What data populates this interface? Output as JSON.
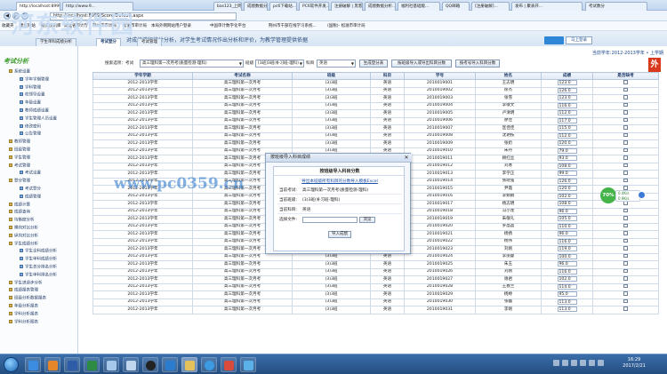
{
  "browser": {
    "address": "http://localhost:8999/Score/Default.aspx",
    "tabs": [
      "http://localhost:8999...",
      "http://www.9...",
      "bas123_上网...",
      "成绩数据分析...",
      "pc6下载站...",
      "PC6软件开发...",
      "注册破解 | 黑客...",
      "成绩数据分析...",
      "福利社基础版...",
      "QQ邮箱",
      "[注册破解]...",
      "发布 | 聚表开...",
      "考试数分"
    ],
    "favorites": [
      "收藏夹",
      "建议网站",
      "网页快讯库",
      "湖北省审计厅",
      "荆州市审计局",
      "松滋市审计局",
      "本局外网网站用户登录",
      "中国审计数字化平台",
      "荆州市干部在线学习系统...",
      "(国税)- 松滋市审计局"
    ]
  },
  "site": {
    "logo": "河东软件园",
    "subtitle": "对成绩进行统计分析，对学生考试情况作出分析和评价，为教学管理提供依据",
    "login_label": "马上登录",
    "watermark_url": "www.pc0359.cn"
  },
  "app_tabs": [
    "学生单科成绩分析",
    "考试登分",
    "考试管理"
  ],
  "sidebar": {
    "title": "考试分析",
    "items": [
      {
        "label": "系统设置",
        "level": 0
      },
      {
        "label": "学年学期管理",
        "level": 1
      },
      {
        "label": "学科管理",
        "level": 1
      },
      {
        "label": "校领导设置",
        "level": 1
      },
      {
        "label": "年级设置",
        "level": 1
      },
      {
        "label": "教师成绩设置",
        "level": 1
      },
      {
        "label": "学生管理人员设置",
        "level": 1
      },
      {
        "label": "修改密码",
        "level": 1
      },
      {
        "label": "公告管理",
        "level": 1
      },
      {
        "label": "教师管理",
        "level": 0
      },
      {
        "label": "班级管理",
        "level": 0
      },
      {
        "label": "学生管理",
        "level": 0
      },
      {
        "label": "考试管理",
        "level": 0
      },
      {
        "label": "考试设置",
        "level": 1
      },
      {
        "label": "登分管理",
        "level": 0
      },
      {
        "label": "考试登分",
        "level": 1
      },
      {
        "label": "成绩管理",
        "level": 1
      },
      {
        "label": "成绩计算",
        "level": 0
      },
      {
        "label": "成绩查询",
        "level": 0
      },
      {
        "label": "均衡度分析",
        "level": 0
      },
      {
        "label": "横向对比分析",
        "level": 0
      },
      {
        "label": "纵向对比分析",
        "level": 0
      },
      {
        "label": "学生成绩分析",
        "level": 0
      },
      {
        "label": "学生全科成绩分析",
        "level": 1
      },
      {
        "label": "学生单科成绩分析",
        "level": 1
      },
      {
        "label": "学生总分排名分析",
        "level": 1
      },
      {
        "label": "学生单科排名分析",
        "level": 1
      },
      {
        "label": "学生进退步分析",
        "level": 0
      },
      {
        "label": "成绩报表管理",
        "level": 0
      },
      {
        "label": "班级分析数据报表",
        "level": 0
      },
      {
        "label": "年级分析报表",
        "level": 0
      },
      {
        "label": "学科分析报表",
        "level": 0
      },
      {
        "label": "学科分析图表",
        "level": 0
      }
    ]
  },
  "breadcrumb": "当前学年:2012-2013学年 • 上学期",
  "toolbar": {
    "label_exam": "搜索选项：考试",
    "exam_value": "高三理科第一次月考(质量检测-理科)",
    "label_class": "班级",
    "class_value": "[3班]3班(补习班-理科)",
    "label_subject": "科目",
    "subject_value": "英语",
    "btn_generate": "生成登分表",
    "btn_import": "按班级导入或导出科目分数",
    "btn_byid": "按考号导入科目分数",
    "badge": "外"
  },
  "table": {
    "headers": [
      "学年学期",
      "考试名称",
      "班级",
      "科目",
      "学号",
      "姓名",
      "成绩",
      "是否缺考"
    ],
    "term": "2012-2013学年",
    "exam": "高三理科第一次月考",
    "cls": "(3)3班",
    "subject": "英语",
    "rows": [
      [
        "2010019001",
        "王志明",
        "123.0"
      ],
      [
        "2010019002",
        "徐杰",
        "126.0"
      ],
      [
        "2010019003",
        "张雪",
        "123.0"
      ],
      [
        "2010019004",
        "李敬文",
        "116.0"
      ],
      [
        "2010019005",
        "卢清明",
        "112.0"
      ],
      [
        "2010019006",
        "廖佳",
        "117.0"
      ],
      [
        "2010019007",
        "匡佳佳",
        "115.0"
      ],
      [
        "2010019008",
        "沈艳枝",
        "112.0"
      ],
      [
        "2010019009",
        "张奶",
        "120.0"
      ],
      [
        "2010019010",
        "朱丹",
        "79.0"
      ],
      [
        "2010019011",
        "顾红丝",
        "93.0"
      ],
      [
        "2010019012",
        "刘寒",
        "108.0"
      ],
      [
        "2010019013",
        "李学正",
        "99.0"
      ],
      [
        "2010019014",
        "张晓强",
        "126.0"
      ],
      [
        "2010019015",
        "尹霞",
        "120.0"
      ],
      [
        "2010019016",
        "李娟娟",
        "102.0"
      ],
      [
        "2010019017",
        "杨志明",
        "108.0"
      ],
      [
        "2010019018",
        "冯小龙",
        "96.0"
      ],
      [
        "2010019019",
        "朱敬礼",
        "105.0"
      ],
      [
        "2010019020",
        "罗晶晶",
        "110.0"
      ],
      [
        "2010019021",
        "杨扬",
        "96.0"
      ],
      [
        "2010019022",
        "杨伟",
        "116.0"
      ],
      [
        "2010019023",
        "刘刚",
        "119.0"
      ],
      [
        "2010019024",
        "李丽曼",
        "100.0"
      ],
      [
        "2010019025",
        "朱玉",
        "96.0"
      ],
      [
        "2010019026",
        "刘刚",
        "116.0"
      ],
      [
        "2010019027",
        "谢君",
        "102.0"
      ],
      [
        "2010019028",
        "王春兰",
        "114.0"
      ],
      [
        "2010019029",
        "杨婷",
        "95.0"
      ],
      [
        "2010019030",
        "张磊",
        "113.0"
      ],
      [
        "2010019031",
        "李刚",
        "113.0"
      ]
    ]
  },
  "dialog": {
    "title": "按班级导入科目成绩",
    "heading": "按班级导入科目分数",
    "link": "导出本班级所有科目的分数导入模板Excel",
    "label_exam": "当前考试:",
    "exam": "高三理科第一次月考(质量检测-理科)",
    "label_class": "当前班级:",
    "cls": "(3)3班(补习班-理科)",
    "label_subject": "当前科目:",
    "subject": "英语",
    "label_file": "选择文件:",
    "browse": "浏览",
    "import": "导入成绩",
    "close": "✕"
  },
  "widget": {
    "percent": "70%",
    "up": "0.4K/s",
    "down": "0.9K/s"
  },
  "taskbar": {
    "time": "16:29",
    "date": "2017/2/21"
  }
}
